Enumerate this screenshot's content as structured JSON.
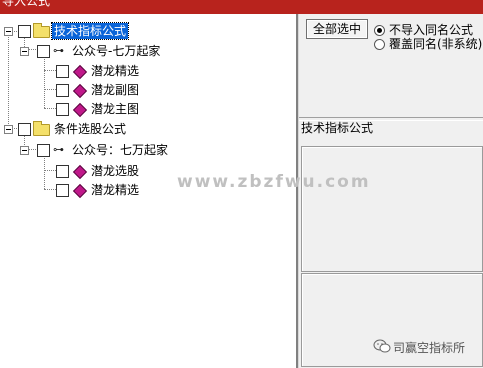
{
  "window": {
    "title": "导入公式"
  },
  "tree": {
    "groups": [
      {
        "label": "技术指标公式",
        "selected": true,
        "account": {
          "label": "公众号-七万起家",
          "items": [
            "潜龙精选",
            "潜龙副图",
            "潜龙主图"
          ]
        }
      },
      {
        "label": "条件选股公式",
        "selected": false,
        "account": {
          "label": "公众号：七万起家",
          "items": [
            "潜龙选股",
            "潜龙精选"
          ]
        }
      }
    ]
  },
  "right_panel": {
    "select_all_button": "全部选中",
    "radio_options": [
      {
        "label": "不导入同名公式",
        "checked": true
      },
      {
        "label": "覆盖同名(非系统)",
        "checked": false
      }
    ],
    "section_title": "技术指标公式"
  },
  "watermark": "www.zbzfwu.com",
  "wechat_badge": "司赢空指标所",
  "colors": {
    "titlebar": "#b8231d",
    "selection": "#0a64d8",
    "diamond_icon": "#c0188a",
    "folder": "#f4e06a"
  }
}
